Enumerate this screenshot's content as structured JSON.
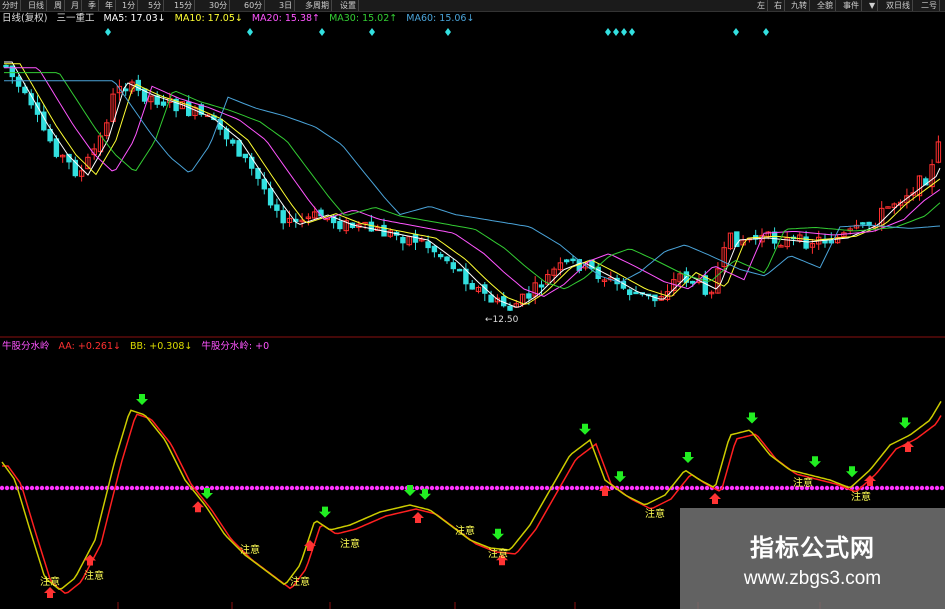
{
  "toolbar": {
    "left": [
      "分时",
      "日线",
      "周",
      "月",
      "季",
      "年",
      "1分",
      "5分",
      "15分",
      "30分",
      "60分",
      "3日",
      "多周期",
      "设置"
    ],
    "right": [
      "左",
      "右",
      "九转",
      "全貌",
      "事件",
      "▼",
      "双日线",
      "二号"
    ]
  },
  "main_legend": {
    "title": "日线(复权)",
    "indicator": "三一重工",
    "ma5": "MA5: 17.03↓",
    "ma10": "MA10: 17.05↓",
    "ma20": "MA20: 15.38↑",
    "ma30": "MA30: 15.02↑",
    "ma60": "MA60: 15.06↓"
  },
  "sub_legend": {
    "title": "牛股分水岭",
    "aa": "AA: +0.261↓",
    "bb": "BB: +0.308↓",
    "line": "牛股分水岭: +0"
  },
  "low_marker": "12.50",
  "signal_label": "注意",
  "colors": {
    "up": "#ff3030",
    "down": "#33e0e0",
    "ma5": "#ffffff",
    "ma10": "#ffff33",
    "ma20": "#ff55ff",
    "ma30": "#33cc33",
    "ma60": "#4aa3d8",
    "aa": "#ff2020",
    "bb": "#cccc00",
    "zero": "#ff33ff",
    "arrow_down": "#22ee22",
    "arrow_up": "#ff3333"
  },
  "watermark": {
    "title": "指标公式网",
    "url": "www.zbgs3.com"
  }
}
